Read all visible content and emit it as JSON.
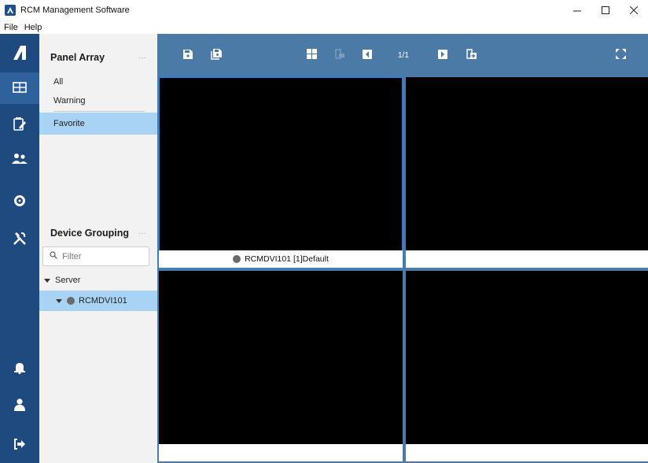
{
  "window": {
    "title": "RCM Management Software",
    "minimize": "–",
    "maximize": "☐",
    "close": "✕"
  },
  "menu": [
    "File",
    "Help"
  ],
  "rail": {
    "items": [
      {
        "icon": "app-logo-icon"
      },
      {
        "icon": "grid-icon",
        "active": true
      },
      {
        "icon": "edit-icon"
      },
      {
        "icon": "users-icon"
      },
      {
        "icon": "settings-icon"
      },
      {
        "icon": "tools-icon"
      },
      {
        "icon": "bell-icon"
      },
      {
        "icon": "user-icon"
      },
      {
        "icon": "logout-icon"
      }
    ]
  },
  "panel_array": {
    "title": "Panel Array",
    "menu": "···",
    "items": [
      {
        "label": "All",
        "selected": false
      },
      {
        "label": "Warning",
        "selected": false
      },
      {
        "label": "Favorite",
        "selected": true
      }
    ]
  },
  "device_grouping": {
    "title": "Device Grouping",
    "menu": "···",
    "filter_placeholder": "Filter",
    "tree": {
      "server_label": "Server",
      "device_label": "RCMDVI101",
      "device_selected": true
    }
  },
  "toolbar": {
    "page_indicator": "1/1"
  },
  "grid": {
    "cells": [
      {
        "label": "RCMDVI101 [1]Default",
        "status_dot": true,
        "selected": true
      },
      {
        "label": "",
        "status_dot": false,
        "selected": false
      },
      {
        "label": "",
        "status_dot": false,
        "selected": false
      },
      {
        "label": "",
        "status_dot": false,
        "selected": false
      }
    ]
  },
  "colors": {
    "rail": "#1e4a80",
    "toolbar": "#4c7aa6",
    "selection": "#a9d3f5",
    "cell_border": "#2d7fd6"
  }
}
